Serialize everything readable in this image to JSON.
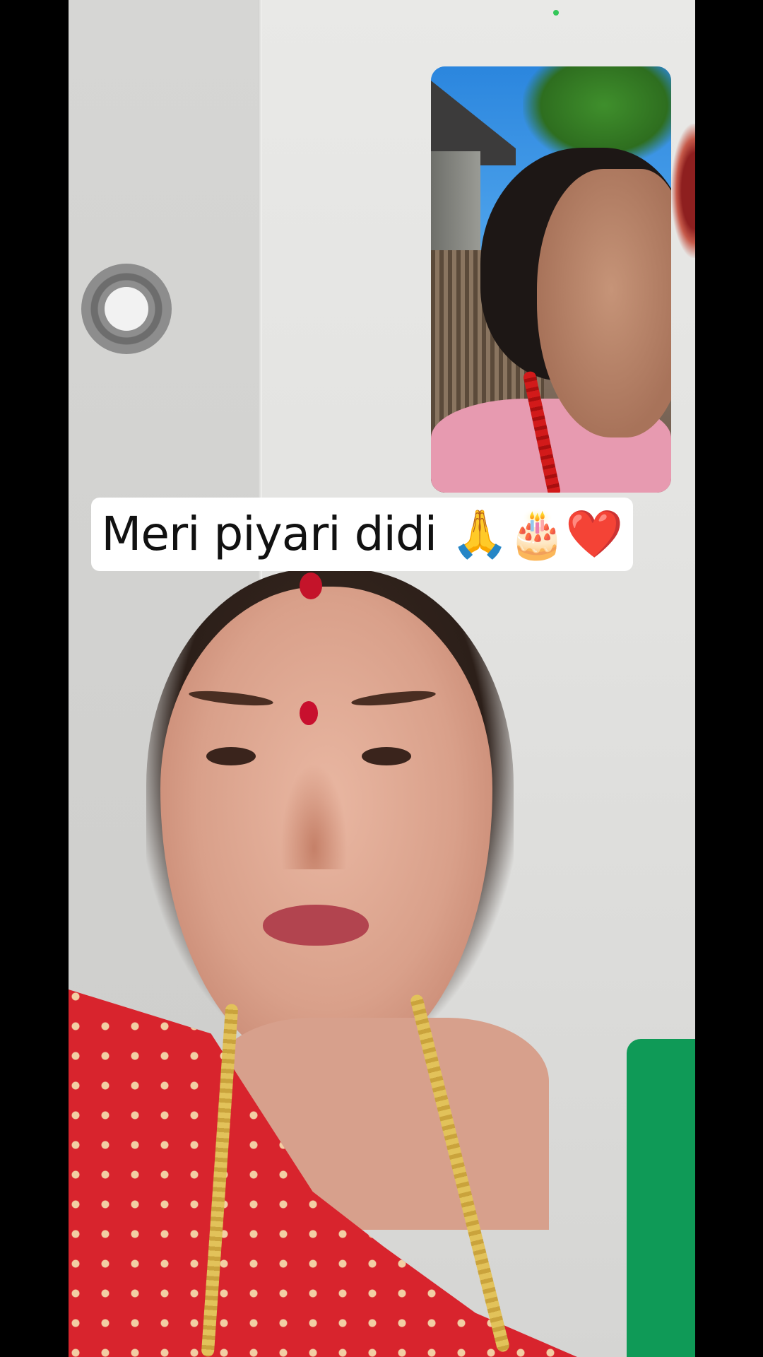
{
  "caption": {
    "text": "Meri piyari didi 🙏🎂❤️"
  },
  "colors": {
    "caption_background": "#ffffff",
    "caption_text": "#111111",
    "status_dot": "#34c759",
    "side_bars": "#000000"
  },
  "icons": {
    "assistive_touch": "assistive-touch-icon",
    "status": "green-status-dot-icon"
  }
}
